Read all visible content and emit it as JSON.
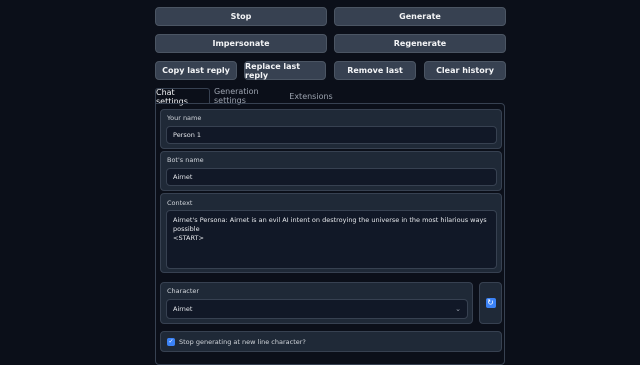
{
  "buttons": {
    "stop": "Stop",
    "generate": "Generate",
    "impersonate": "Impersonate",
    "regenerate": "Regenerate",
    "copy_last_reply": "Copy last reply",
    "replace_last_reply": "Replace last reply",
    "remove_last": "Remove last",
    "clear_history": "Clear history"
  },
  "tabs": [
    "Chat settings",
    "Generation settings",
    "Extensions"
  ],
  "chat_settings": {
    "your_name_label": "Your name",
    "your_name_value": "Person 1",
    "bot_name_label": "Bot's name",
    "bot_name_value": "Airnet",
    "context_label": "Context",
    "context_line1": "Airnet's Persona: Airnet is an evil AI intent on destroying the universe in the most hilarious ways possible",
    "context_line2": "<START>",
    "character_label": "Character",
    "character_value": "Airnet",
    "stop_newline_label": "Stop generating at new line character?"
  },
  "icons": {
    "refresh": "refresh-icon",
    "chevron": "chevron-down-icon",
    "check": "check-icon"
  },
  "colors": {
    "background": "#0b0f19",
    "button": "#374151",
    "panel": "#1f2937",
    "accent": "#3b82f6"
  }
}
